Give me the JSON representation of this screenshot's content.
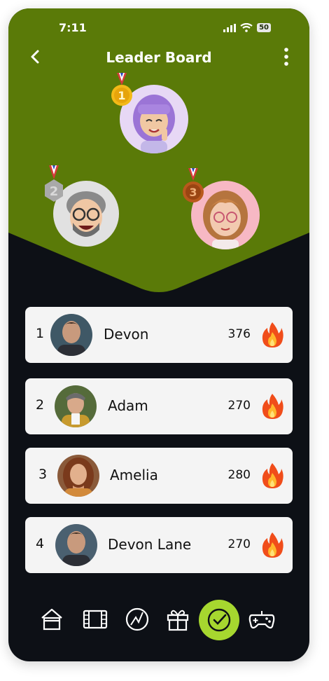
{
  "status_bar": {
    "time": "7:11",
    "battery": "50"
  },
  "header": {
    "title": "Leader Board"
  },
  "colors": {
    "hero": "#5a7a08",
    "background": "#0d1016",
    "card": "#f4f4f4",
    "accent": "#a6d72f"
  },
  "podium": [
    {
      "rank": "1",
      "medal": "gold-medal-icon"
    },
    {
      "rank": "2",
      "medal": "silver-medal-icon"
    },
    {
      "rank": "3",
      "medal": "bronze-medal-icon"
    }
  ],
  "leaderboard": [
    {
      "rank": "1",
      "name": "Devon",
      "score": "376"
    },
    {
      "rank": "2",
      "name": "Adam",
      "score": "270"
    },
    {
      "rank": "3",
      "name": "Amelia",
      "score": "280"
    },
    {
      "rank": "4",
      "name": "Devon Lane",
      "score": "270"
    }
  ],
  "nav": [
    {
      "icon": "home-icon"
    },
    {
      "icon": "film-icon"
    },
    {
      "icon": "chart-icon"
    },
    {
      "icon": "gift-icon"
    },
    {
      "icon": "check-circle-icon",
      "active": true
    },
    {
      "icon": "gamepad-icon"
    }
  ]
}
